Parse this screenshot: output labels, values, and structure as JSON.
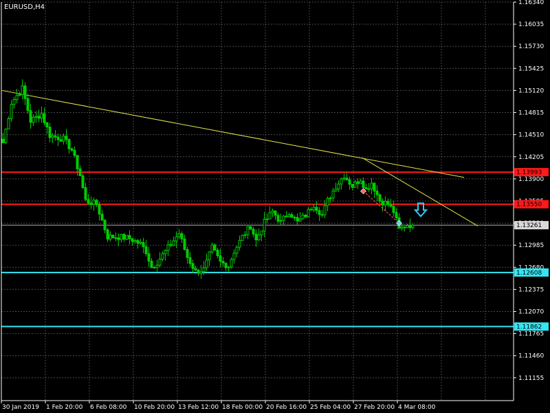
{
  "window": {
    "title": "EURUSD,H4"
  },
  "colors": {
    "background": "#000000",
    "grid": "#4a4a4a",
    "axis": "#ffffff",
    "candle_up": "#00cc00",
    "candle_down": "#00cc00",
    "trendline": "#e6e64c",
    "resistance": "#ff1a1a",
    "support": "#33e6f2",
    "current_price": "#b0b0b0",
    "current_price_tag": "#d9d9d9",
    "signal_arrow": "#33ccff",
    "order_marker_sell": "#ff6666",
    "order_marker_current": "#66ccff"
  },
  "icons": {
    "signal": "arrow-down-icon"
  },
  "chart_data": {
    "type": "candlestick",
    "symbol": "EURUSD",
    "timeframe": "H4",
    "title": "EURUSD,H4",
    "ylim": [
      1.1084,
      1.1634
    ],
    "y_ticks": [
      "1.16340",
      "1.16035",
      "1.15730",
      "1.15425",
      "1.15120",
      "1.14815",
      "1.14510",
      "1.14205",
      "1.13900",
      "1.13595",
      "1.13290",
      "1.12985",
      "1.12680",
      "1.12375",
      "1.12070",
      "1.11765",
      "1.11460",
      "1.11155"
    ],
    "x_ticks": [
      "30 Jan 2019",
      "1 Feb 20:00",
      "6 Feb 08:00",
      "10 Feb 20:00",
      "13 Feb 12:00",
      "18 Feb 00:00",
      "20 Feb 16:00",
      "25 Feb 04:00",
      "27 Feb 20:00",
      "4 Mar 08:00"
    ],
    "grid": true,
    "current_price": {
      "value": 1.13261,
      "label": "1.13261"
    },
    "horizontal_levels": [
      {
        "kind": "resistance",
        "value": 1.13993,
        "label": "1.13993"
      },
      {
        "kind": "resistance",
        "value": 1.1355,
        "label": "1.13550"
      },
      {
        "kind": "support",
        "value": 1.12608,
        "label": "1.12608"
      },
      {
        "kind": "support",
        "value": 1.11862,
        "label": "1.11862"
      }
    ],
    "trendlines": [
      {
        "from_bar": 0,
        "from_price": 1.1512,
        "to_bar": 168,
        "to_price": 1.1392
      },
      {
        "from_bar": 131,
        "from_price": 1.1419,
        "to_bar": 173,
        "to_price": 1.1325
      }
    ],
    "markers": [
      {
        "kind": "sell-entry",
        "bar": 131,
        "price": 1.1373
      },
      {
        "kind": "current",
        "bar": 144,
        "price": 1.1329
      }
    ],
    "signal_arrow": {
      "direction": "down",
      "bar": 152,
      "price": 1.1345
    },
    "waypoints": [
      [
        0,
        1.144
      ],
      [
        3,
        1.1495
      ],
      [
        7,
        1.1515
      ],
      [
        10,
        1.147
      ],
      [
        14,
        1.148
      ],
      [
        17,
        1.145
      ],
      [
        22,
        1.1445
      ],
      [
        25,
        1.143
      ],
      [
        28,
        1.1395
      ],
      [
        30,
        1.136
      ],
      [
        34,
        1.1355
      ],
      [
        38,
        1.131
      ],
      [
        42,
        1.131
      ],
      [
        46,
        1.1308
      ],
      [
        50,
        1.13
      ],
      [
        52,
        1.129
      ],
      [
        54,
        1.1268
      ],
      [
        56,
        1.1275
      ],
      [
        58,
        1.1285
      ],
      [
        61,
        1.13
      ],
      [
        64,
        1.1315
      ],
      [
        67,
        1.1282
      ],
      [
        70,
        1.1262
      ],
      [
        73,
        1.1265
      ],
      [
        76,
        1.1295
      ],
      [
        79,
        1.1275
      ],
      [
        82,
        1.127
      ],
      [
        84,
        1.129
      ],
      [
        87,
        1.131
      ],
      [
        90,
        1.1325
      ],
      [
        92,
        1.1305
      ],
      [
        95,
        1.133
      ],
      [
        98,
        1.1345
      ],
      [
        101,
        1.133
      ],
      [
        104,
        1.1345
      ],
      [
        107,
        1.133
      ],
      [
        110,
        1.134
      ],
      [
        113,
        1.1355
      ],
      [
        116,
        1.134
      ],
      [
        118,
        1.136
      ],
      [
        121,
        1.138
      ],
      [
        124,
        1.1395
      ],
      [
        127,
        1.138
      ],
      [
        130,
        1.139
      ],
      [
        132,
        1.1375
      ],
      [
        134,
        1.1385
      ],
      [
        137,
        1.136
      ],
      [
        140,
        1.1355
      ],
      [
        142,
        1.1345
      ],
      [
        144,
        1.132
      ],
      [
        147,
        1.1327
      ],
      [
        149,
        1.1326
      ]
    ]
  }
}
